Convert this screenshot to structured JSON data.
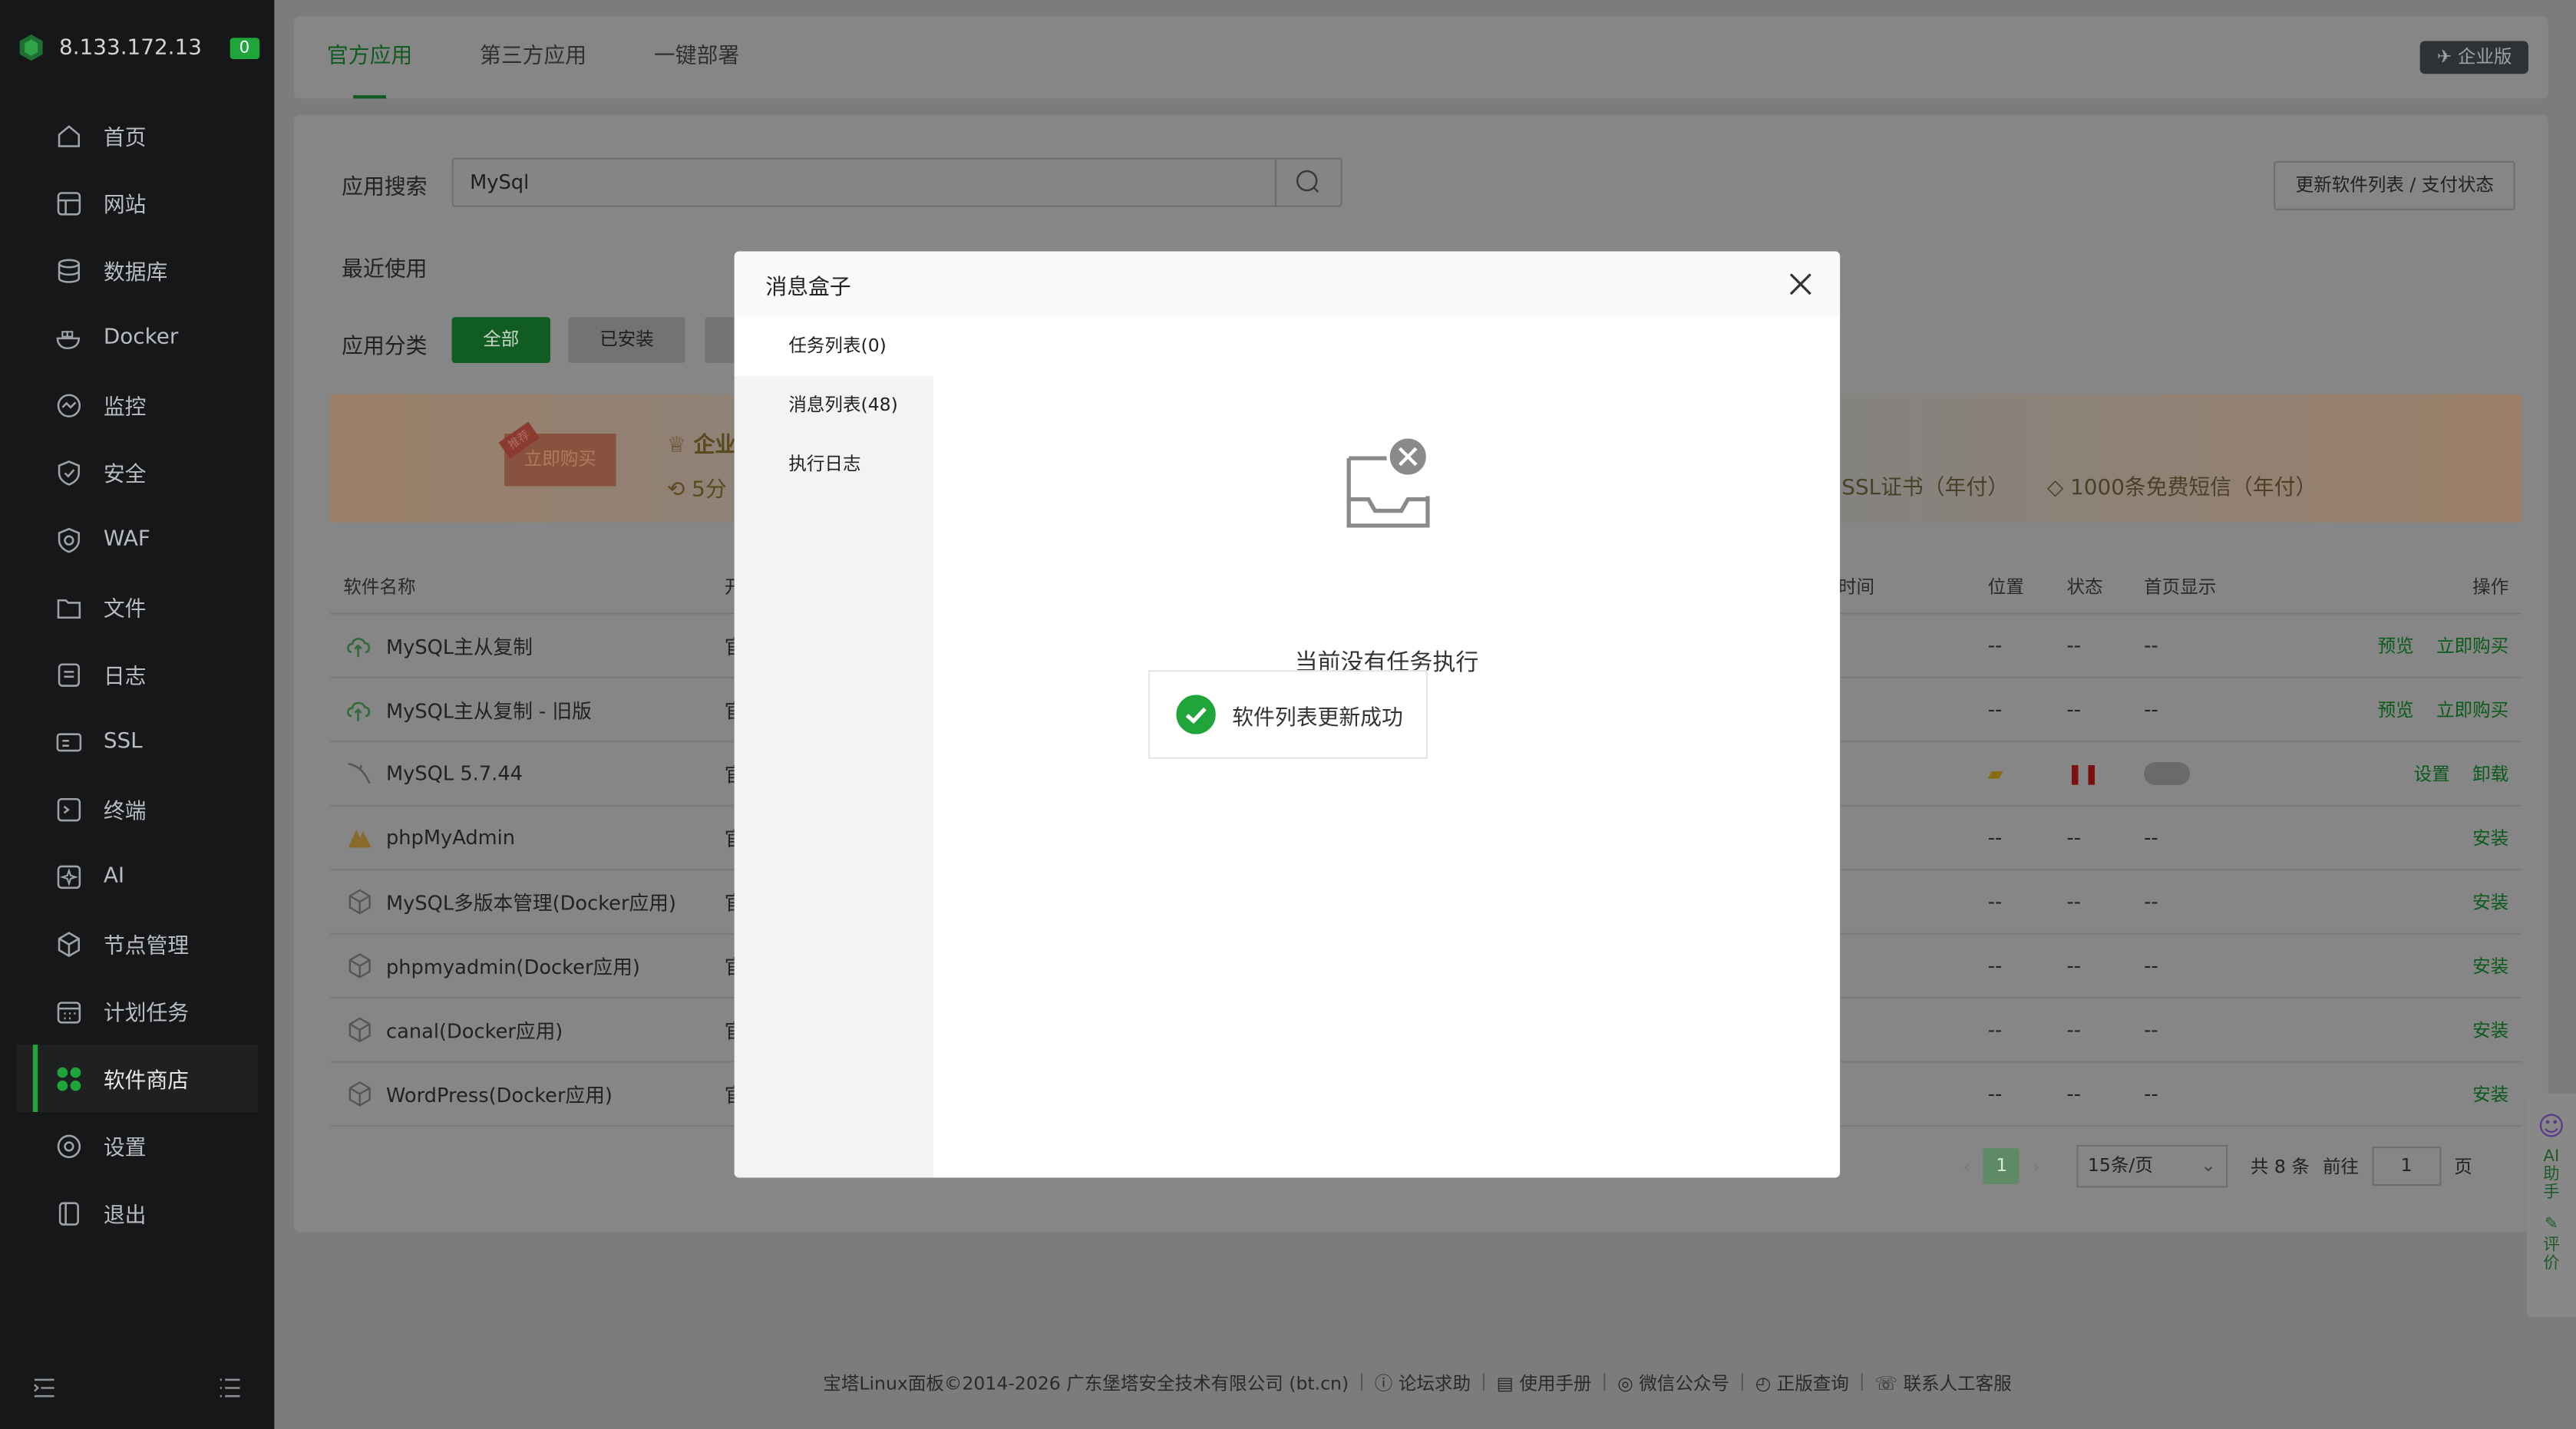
{
  "sidebar": {
    "ip": "8.133.172.13",
    "badge": "0",
    "items": [
      {
        "label": "首页",
        "icon": "home-icon"
      },
      {
        "label": "网站",
        "icon": "globe-icon"
      },
      {
        "label": "数据库",
        "icon": "database-icon"
      },
      {
        "label": "Docker",
        "icon": "docker-icon"
      },
      {
        "label": "监控",
        "icon": "monitor-icon"
      },
      {
        "label": "安全",
        "icon": "shield-icon"
      },
      {
        "label": "WAF",
        "icon": "waf-icon"
      },
      {
        "label": "文件",
        "icon": "folder-icon"
      },
      {
        "label": "日志",
        "icon": "log-icon"
      },
      {
        "label": "SSL",
        "icon": "ssl-icon"
      },
      {
        "label": "终端",
        "icon": "terminal-icon"
      },
      {
        "label": "AI",
        "icon": "ai-icon"
      },
      {
        "label": "节点管理",
        "icon": "node-icon"
      },
      {
        "label": "计划任务",
        "icon": "calendar-icon"
      },
      {
        "label": "软件商店",
        "icon": "store-icon"
      },
      {
        "label": "设置",
        "icon": "gear-icon"
      },
      {
        "label": "退出",
        "icon": "logout-icon"
      }
    ],
    "active_index": 14
  },
  "topbar": {
    "tabs": [
      "官方应用",
      "第三方应用",
      "一键部署"
    ],
    "enterprise": "企业版"
  },
  "panel": {
    "search_label": "应用搜索",
    "search_value": "MySql",
    "update_button": "更新软件列表 / 支付状态",
    "recent_label": "最近使用",
    "category_label": "应用分类",
    "category_all": "全部",
    "category_installed": "已安装"
  },
  "banner": {
    "buy": "立即购买",
    "tag": "推荐",
    "enterprise": "企业",
    "five": "5分",
    "ssl": "SSL证书（年付）",
    "sms": "1000条免费短信（年付）"
  },
  "table": {
    "headers": {
      "name": "软件名称",
      "type": "开",
      "time": "时间",
      "pos": "位置",
      "status": "状态",
      "home": "首页显示",
      "op": "操作"
    },
    "rows": [
      {
        "name": "MySQL主从复制",
        "type": "官",
        "time": "",
        "pos": "--",
        "status": "--",
        "home": "--",
        "ops": [
          "预览",
          "立即购买"
        ]
      },
      {
        "name": "MySQL主从复制 - 旧版",
        "type": "官",
        "time": "",
        "pos": "--",
        "status": "--",
        "home": "--",
        "ops": [
          "预览",
          "立即购买"
        ]
      },
      {
        "name": "MySQL 5.7.44",
        "type": "官",
        "time": "",
        "pos": "",
        "status": "",
        "home": "",
        "ops": [
          "设置",
          "卸载"
        ]
      },
      {
        "name": "phpMyAdmin",
        "type": "官",
        "time": "",
        "pos": "--",
        "status": "--",
        "home": "--",
        "ops": [
          "安装"
        ]
      },
      {
        "name": "MySQL多版本管理(Docker应用)",
        "type": "官",
        "time": "",
        "pos": "--",
        "status": "--",
        "home": "--",
        "ops": [
          "安装"
        ]
      },
      {
        "name": "phpmyadmin(Docker应用)",
        "type": "官",
        "time": "",
        "pos": "--",
        "status": "--",
        "home": "--",
        "ops": [
          "安装"
        ]
      },
      {
        "name": "canal(Docker应用)",
        "type": "官",
        "time": "",
        "pos": "--",
        "status": "--",
        "home": "--",
        "ops": [
          "安装"
        ]
      },
      {
        "name": "WordPress(Docker应用)",
        "type": "官",
        "time": "",
        "pos": "--",
        "status": "--",
        "home": "--",
        "ops": [
          "安装"
        ]
      }
    ]
  },
  "pager": {
    "page": "1",
    "size": "15条/页",
    "total": "共 8 条",
    "goto": "前往",
    "goto_value": "1",
    "page_unit": "页"
  },
  "footer": {
    "copyright": "宝塔Linux面板©2014-2026 广东堡塔安全技术有限公司 (bt.cn)",
    "links": [
      "论坛求助",
      "使用手册",
      "微信公众号",
      "正版查询",
      "联系人工客服"
    ]
  },
  "ai_side": {
    "ai": "AI助手",
    "rate": "评价"
  },
  "modal": {
    "title": "消息盒子",
    "side_items": [
      "任务列表(0)",
      "消息列表(48)",
      "执行日志"
    ],
    "empty_text": "当前没有任务执行",
    "toast": "软件列表更新成功"
  },
  "colors": {
    "accent": "#20a53a",
    "dark_accent": "#115c22"
  }
}
